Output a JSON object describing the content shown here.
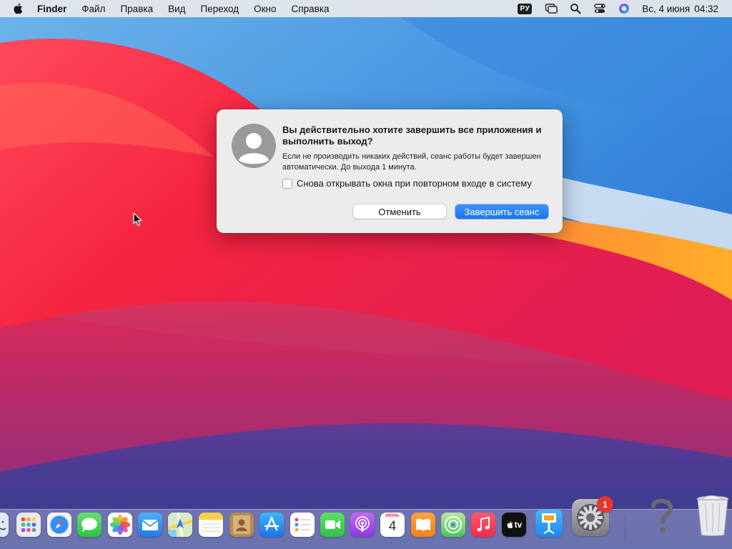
{
  "menubar": {
    "items": [
      {
        "label": "Finder"
      },
      {
        "label": "Файл"
      },
      {
        "label": "Правка"
      },
      {
        "label": "Вид"
      },
      {
        "label": "Переход"
      },
      {
        "label": "Окно"
      },
      {
        "label": "Справка"
      }
    ],
    "input_source": "РУ",
    "date": "Вс, 4 июня",
    "time": "04:32",
    "status_icons": [
      "screen-mirroring-icon",
      "spotlight-search-icon",
      "control-center-icon",
      "siri-icon"
    ]
  },
  "dialog": {
    "title": "Вы действительно хотите завершить все приложения и выполнить выход?",
    "message": "Если не производить никаких действий, сеанс работы будет завершен автоматически. До выхода 1 минута.",
    "checkbox_label": "Снова открывать окна при повторном входе в систему",
    "checkbox_checked": false,
    "cancel_label": "Отменить",
    "confirm_label": "Завершить сеанс",
    "accent_color": "#1a76ee"
  },
  "dock": {
    "apps": [
      {
        "icon": "finder-icon"
      },
      {
        "icon": "launchpad-icon"
      },
      {
        "icon": "safari-icon"
      },
      {
        "icon": "messages-icon"
      },
      {
        "icon": "photos-icon"
      },
      {
        "icon": "mail-icon"
      },
      {
        "icon": "maps-icon"
      },
      {
        "icon": "notes-icon"
      },
      {
        "icon": "contacts-icon"
      },
      {
        "icon": "app-store-icon"
      },
      {
        "icon": "reminders-icon"
      },
      {
        "icon": "facetime-icon"
      },
      {
        "icon": "podcasts-icon"
      },
      {
        "icon": "calendar-icon"
      },
      {
        "icon": "books-icon"
      },
      {
        "icon": "find-my-icon"
      },
      {
        "icon": "music-icon"
      },
      {
        "icon": "apple-tv-icon"
      },
      {
        "icon": "keynote-icon"
      },
      {
        "icon": "system-preferences-icon"
      },
      {
        "icon": "unknown-app-icon"
      },
      {
        "icon": "trash-icon"
      }
    ],
    "calendar_month": "ИЮНЬ",
    "calendar_day": "4",
    "tv_label": "tv",
    "system_preferences_badge": "1"
  }
}
